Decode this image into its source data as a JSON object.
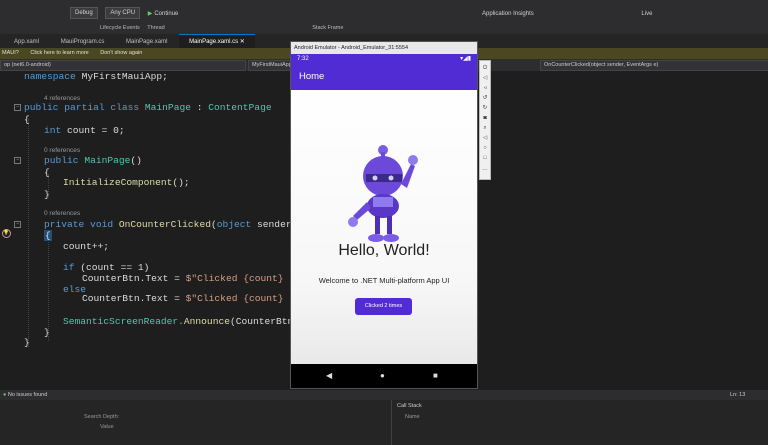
{
  "toolbar": {
    "items": [
      "Debug",
      "Any CPU",
      "Continue",
      "Application Insights",
      "Live"
    ]
  },
  "toolbar2": {
    "lifecycle": "Lifecycle Events",
    "thread": "Thread",
    "stack_frame": "Stack Frame"
  },
  "tabs": [
    {
      "label": "App.xaml"
    },
    {
      "label": "MauiProgram.cs"
    },
    {
      "label": "MainPage.xaml"
    },
    {
      "label": "MainPage.xaml.cs"
    }
  ],
  "infobar": {
    "prefix": "MAUI?",
    "link1": "Click here to learn more",
    "link2": "Don't show again"
  },
  "navbar": {
    "project": "op (net6.0-android)",
    "class": "MyFirstMauiApp",
    "member": "OnCounterClicked(object sender, EventArgs e)"
  },
  "code": {
    "ns_kw": "namespace",
    "ns_name": " MyFirstMauiApp;",
    "refs4": "4 references",
    "class_mods": "public partial class ",
    "class_name": "MainPage",
    "class_sep": " : ",
    "class_base": "ContentPage",
    "brace_open": "{",
    "brace_close": "}",
    "field_kw": "int",
    "field_rest": " count = 0;",
    "refs0a": "0 references",
    "ctor_kw": "public ",
    "ctor_name": "MainPage",
    "ctor_rest": "()",
    "init_call": "InitializeComponent",
    "init_rest": "();",
    "refs0b": "0 references",
    "method_mods": "private void ",
    "method_name": "OnCounterClicked",
    "method_rest": "(",
    "method_obj": "object",
    "method_args": " sender, EventA",
    "count_inc": "count++;",
    "if_kw": "if",
    "if_rest": " (count == 1)",
    "line_a1": "CounterBtn.Text = ",
    "line_a2": "$\"Clicked {count} time\";",
    "else_kw": "else",
    "line_b1": "CounterBtn.Text = ",
    "line_b2": "$\"Clicked {count} times\";",
    "announce1": "SemanticScreenReader.",
    "announce2": "Announce",
    "announce3": "(CounterBtn.Text);"
  },
  "status": {
    "issues": "No issues found",
    "position": "Ln: 13",
    "col": "Ch: 13"
  },
  "bottom": {
    "search": "Search Depth:",
    "value_col": "Value",
    "callstack": "Call Stack",
    "name_col": "Name"
  },
  "emulator": {
    "window_title": "Android Emulator - Android_Emulator_31:5554",
    "time": "7:32",
    "app_title": "Home",
    "hello": "Hello, World!",
    "welcome": "Welcome to .NET Multi-platform App UI",
    "button": "Clicked 2 times"
  },
  "colors": {
    "accent": "#512bd4",
    "editor_bg": "#1e1e1e",
    "keyword": "#569cd6",
    "type": "#4ec9b0",
    "method": "#dcdcaa",
    "string": "#d69d85"
  }
}
